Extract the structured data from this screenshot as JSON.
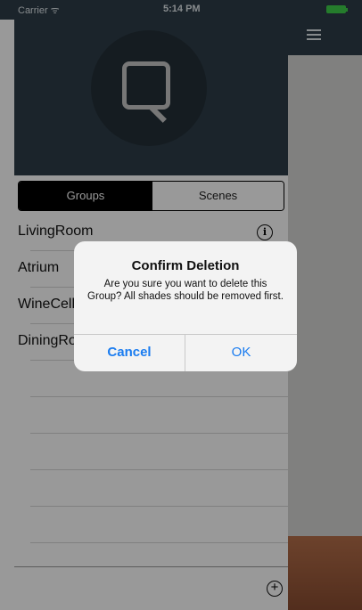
{
  "status_bar": {
    "carrier": "Carrier ᯤ",
    "time": "5:14 PM"
  },
  "tabs": {
    "groups": "Groups",
    "scenes": "Scenes"
  },
  "groups": [
    "LivingRoom",
    "Atrium",
    "WineCellar",
    "DiningRoom"
  ],
  "alert": {
    "title": "Confirm Deletion",
    "message": "Are you sure you want to delete this Group?  All shades should be removed first.",
    "cancel": "Cancel",
    "ok": "OK"
  },
  "icons": {
    "menu": "hamburger-menu-icon",
    "info": "info-icon",
    "add": "add-circle-icon",
    "logo": "q-logo"
  },
  "colors": {
    "header": "#2e3d49",
    "accent": "#1a7cf0",
    "segment_selected": "#000000"
  }
}
